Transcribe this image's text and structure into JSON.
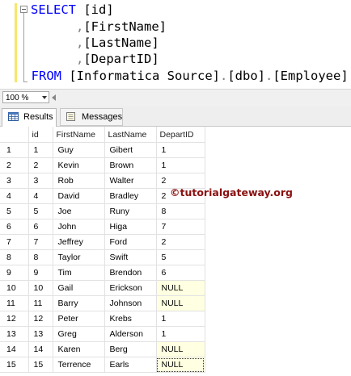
{
  "editor": {
    "line1": {
      "keyword": "SELECT",
      "rest": " [id]"
    },
    "line2": {
      "comma": ",",
      "ident": "[FirstName]"
    },
    "line3": {
      "comma": ",",
      "ident": "[LastName]"
    },
    "line4": {
      "comma": ",",
      "ident": "[DepartID]"
    },
    "line5": {
      "keyword": "FROM",
      "db": "[Informatica Source]",
      "dot1": ".",
      "schema": "[dbo]",
      "dot2": ".",
      "table": "[Employee]"
    }
  },
  "zoom": {
    "value": "100 %"
  },
  "tabs": {
    "results": "Results",
    "messages": "Messages"
  },
  "grid": {
    "columns": [
      "id",
      "FirstName",
      "LastName",
      "DepartID"
    ],
    "rows": [
      {
        "n": "1",
        "id": "1",
        "first": "Guy",
        "last": "Gibert",
        "dept": "1"
      },
      {
        "n": "2",
        "id": "2",
        "first": "Kevin",
        "last": "Brown",
        "dept": "1"
      },
      {
        "n": "3",
        "id": "3",
        "first": "Rob",
        "last": "Walter",
        "dept": "2"
      },
      {
        "n": "4",
        "id": "4",
        "first": "David",
        "last": "Bradley",
        "dept": "2"
      },
      {
        "n": "5",
        "id": "5",
        "first": "Joe",
        "last": "Runy",
        "dept": "8"
      },
      {
        "n": "6",
        "id": "6",
        "first": "John",
        "last": "Higa",
        "dept": "7"
      },
      {
        "n": "7",
        "id": "7",
        "first": "Jeffrey",
        "last": "Ford",
        "dept": "2"
      },
      {
        "n": "8",
        "id": "8",
        "first": "Taylor",
        "last": "Swift",
        "dept": "5"
      },
      {
        "n": "9",
        "id": "9",
        "first": "Tim",
        "last": "Brendon",
        "dept": "6"
      },
      {
        "n": "10",
        "id": "10",
        "first": "Gail",
        "last": "Erickson",
        "dept": "NULL"
      },
      {
        "n": "11",
        "id": "11",
        "first": "Barry",
        "last": "Johnson",
        "dept": "NULL"
      },
      {
        "n": "12",
        "id": "12",
        "first": "Peter",
        "last": "Krebs",
        "dept": "1"
      },
      {
        "n": "13",
        "id": "13",
        "first": "Greg",
        "last": "Alderson",
        "dept": "1"
      },
      {
        "n": "14",
        "id": "14",
        "first": "Karen",
        "last": "Berg",
        "dept": "NULL"
      },
      {
        "n": "15",
        "id": "15",
        "first": "Terrence",
        "last": "Earls",
        "dept": "NULL"
      }
    ]
  },
  "watermark": "©tutorialgateway.org",
  "colors": {
    "keyword": "#0000ff",
    "punct": "#808080",
    "null_bg": "#ffffe1",
    "watermark": "#8a1010"
  }
}
